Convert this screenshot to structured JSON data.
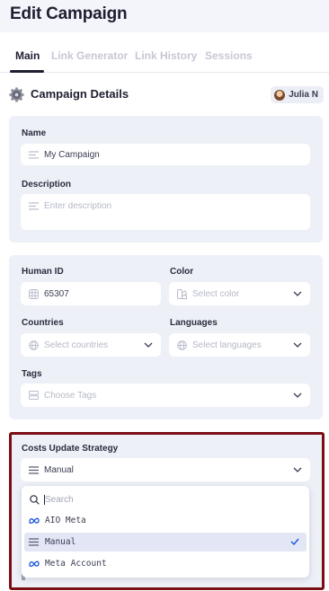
{
  "page": {
    "title": "Edit Campaign"
  },
  "tabs": [
    {
      "label": "Main",
      "active": true
    },
    {
      "label": "Link Generator",
      "active": false
    },
    {
      "label": "Link History",
      "active": false
    },
    {
      "label": "Sessions",
      "active": false
    }
  ],
  "section": {
    "title": "Campaign Details",
    "icon": "gear-icon"
  },
  "user": {
    "name": "Julia N"
  },
  "basic": {
    "name_label": "Name",
    "name_value": "My Campaign",
    "description_label": "Description",
    "description_placeholder": "Enter description"
  },
  "details": {
    "human_id_label": "Human ID",
    "human_id_value": "65307",
    "color_label": "Color",
    "color_placeholder": "Select color",
    "countries_label": "Countries",
    "countries_placeholder": "Select countries",
    "languages_label": "Languages",
    "languages_placeholder": "Select languages",
    "tags_label": "Tags",
    "tags_placeholder": "Choose Tags"
  },
  "costs": {
    "label": "Costs Update Strategy",
    "selected": "Manual",
    "search_placeholder": "Search",
    "options": [
      {
        "label": "AIO Meta",
        "icon": "meta-icon",
        "selected": false
      },
      {
        "label": "Manual",
        "icon": "list-icon",
        "selected": true
      },
      {
        "label": "Meta Account",
        "icon": "meta-icon",
        "selected": false
      }
    ]
  },
  "colors": {
    "accent_highlight": "#7a0e14",
    "card_bg": "#eef0f8",
    "selected_option_bg": "#e3e6f5",
    "meta_blue": "#1a56db"
  }
}
